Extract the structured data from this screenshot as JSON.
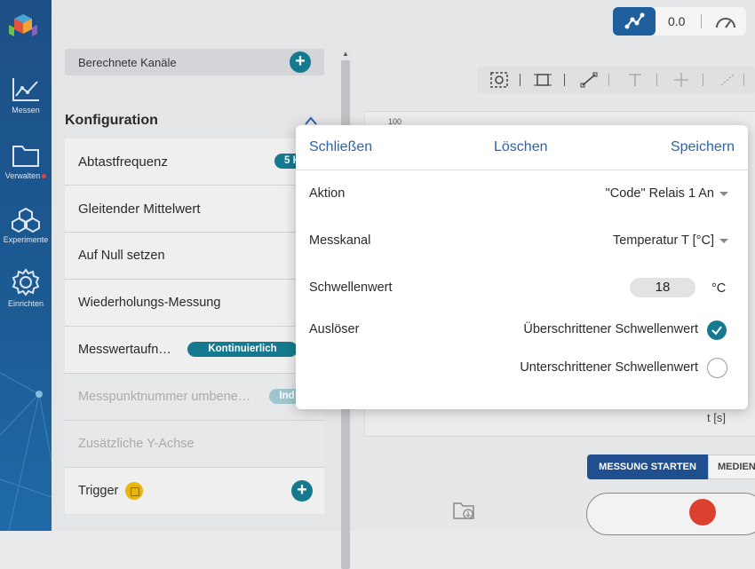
{
  "nav": {
    "items": [
      {
        "label": "Messen",
        "icon": "line-chart-icon"
      },
      {
        "label": "Verwalten",
        "icon": "folder-icon"
      },
      {
        "label": "Experimente",
        "icon": "cubes-icon"
      },
      {
        "label": "Einrichten",
        "icon": "gear-icon"
      }
    ]
  },
  "topbar": {
    "value": "0.0"
  },
  "panel": {
    "calc_label": "Berechnete Kanäle",
    "config_heading": "Konfiguration",
    "rows": [
      {
        "label": "Abtastfrequenz",
        "badge": "5 H"
      },
      {
        "label": "Gleitender Mittelwert"
      },
      {
        "label": "Auf Null setzen"
      },
      {
        "label": "Wiederholungs-Messung"
      },
      {
        "label": "Messwertaufn…",
        "badge": "Kontinuierlich"
      },
      {
        "label": "Messpunktnummer umbene…",
        "badge": "Ind"
      },
      {
        "label": "Zusätzliche Y-Achse"
      },
      {
        "label": "Trigger"
      }
    ]
  },
  "chart": {
    "xlabel": "t [s]",
    "ytick": "100"
  },
  "bottom": {
    "start_label": "MESSUNG STARTEN",
    "media_label": "MEDIEN"
  },
  "modal": {
    "close_label": "Schließen",
    "delete_label": "Löschen",
    "save_label": "Speichern",
    "action_label": "Aktion",
    "action_value": "\"Code\" Relais 1 An",
    "channel_label": "Messkanal",
    "channel_value": "Temperatur T [°C]",
    "threshold_label": "Schwellenwert",
    "threshold_value": "18",
    "threshold_unit": "°C",
    "trigger_label": "Auslöser",
    "options": [
      {
        "label": "Überschrittener Schwellenwert",
        "selected": true
      },
      {
        "label": "Unterschrittener Schwellenwert",
        "selected": false
      }
    ]
  },
  "colors": {
    "accent": "#157a8f",
    "nav": "#1c5a93",
    "link": "#2d63a7"
  }
}
